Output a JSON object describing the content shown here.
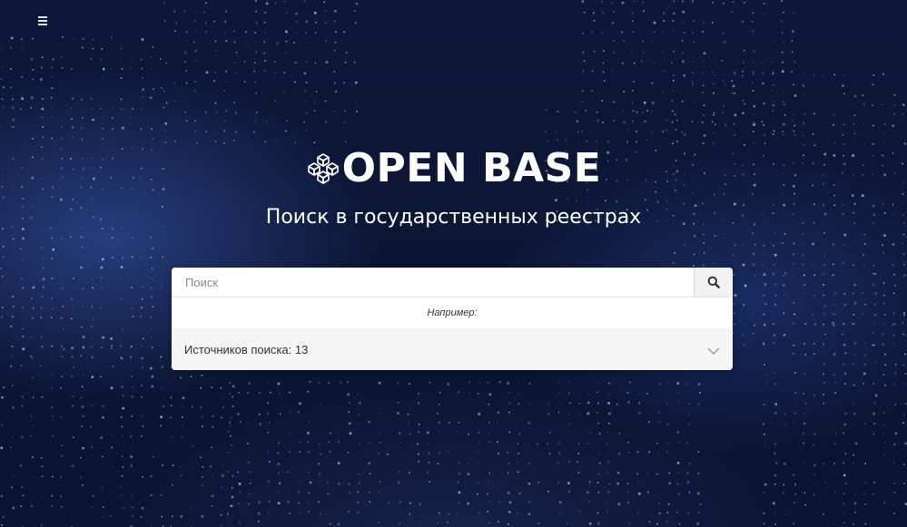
{
  "header": {
    "menu_icon": "hamburger-menu-icon"
  },
  "hero": {
    "logo_icon": "cubes-logo-icon",
    "logo_text": "OPEN BASE",
    "tagline": "Поиск в государственных реестрах"
  },
  "search": {
    "placeholder": "Поиск",
    "value": "",
    "button_icon": "search-icon",
    "example_label": "Например:",
    "sources_label": "Источников поиска: 13",
    "sources_toggle_icon": "chevron-down-icon"
  },
  "colors": {
    "background": "#0c1635",
    "text_light": "#ffffff",
    "card": "#ffffff",
    "sources_row": "#f5f5f5"
  }
}
